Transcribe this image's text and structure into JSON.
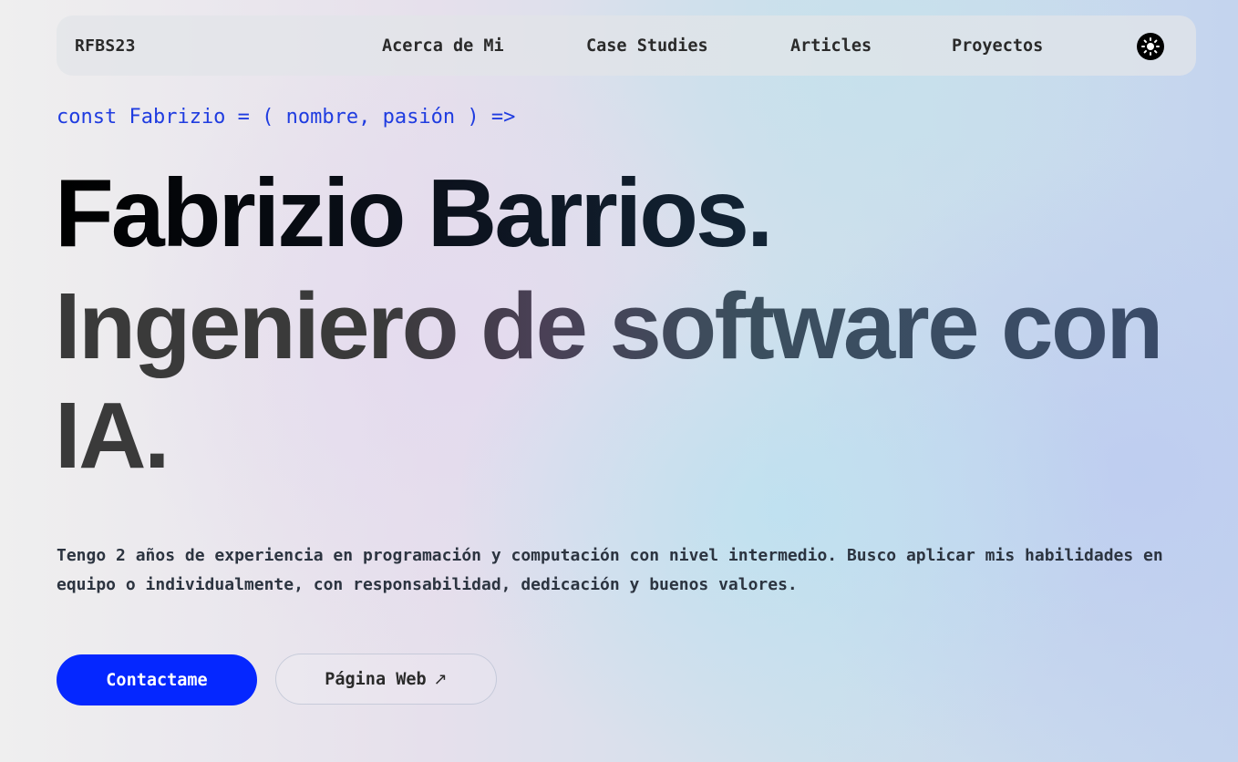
{
  "navbar": {
    "brand": "RFBS23",
    "links": [
      {
        "label": "Acerca de Mi"
      },
      {
        "label": "Case Studies"
      },
      {
        "label": "Articles"
      },
      {
        "label": "Proyectos"
      }
    ],
    "theme_toggle_icon": "sun-icon"
  },
  "hero": {
    "code_line": "const Fabrizio = ( nombre, pasión ) =>",
    "name": "Fabrizio Barrios.",
    "role": "Ingeniero de software con IA.",
    "intro": "Tengo 2 años de experiencia en programación y computación con nivel intermedio. Busco aplicar mis habilidades en equipo o individualmente, con responsabilidad, dedicación y buenos valores.",
    "primary_button": "Contactame",
    "secondary_button": "Página Web",
    "secondary_button_icon": "external-arrow-icon",
    "secondary_button_arrow": "↗"
  },
  "colors": {
    "accent": "#0527ff",
    "code": "#1f3ce0",
    "text": "#2a2a2a"
  }
}
